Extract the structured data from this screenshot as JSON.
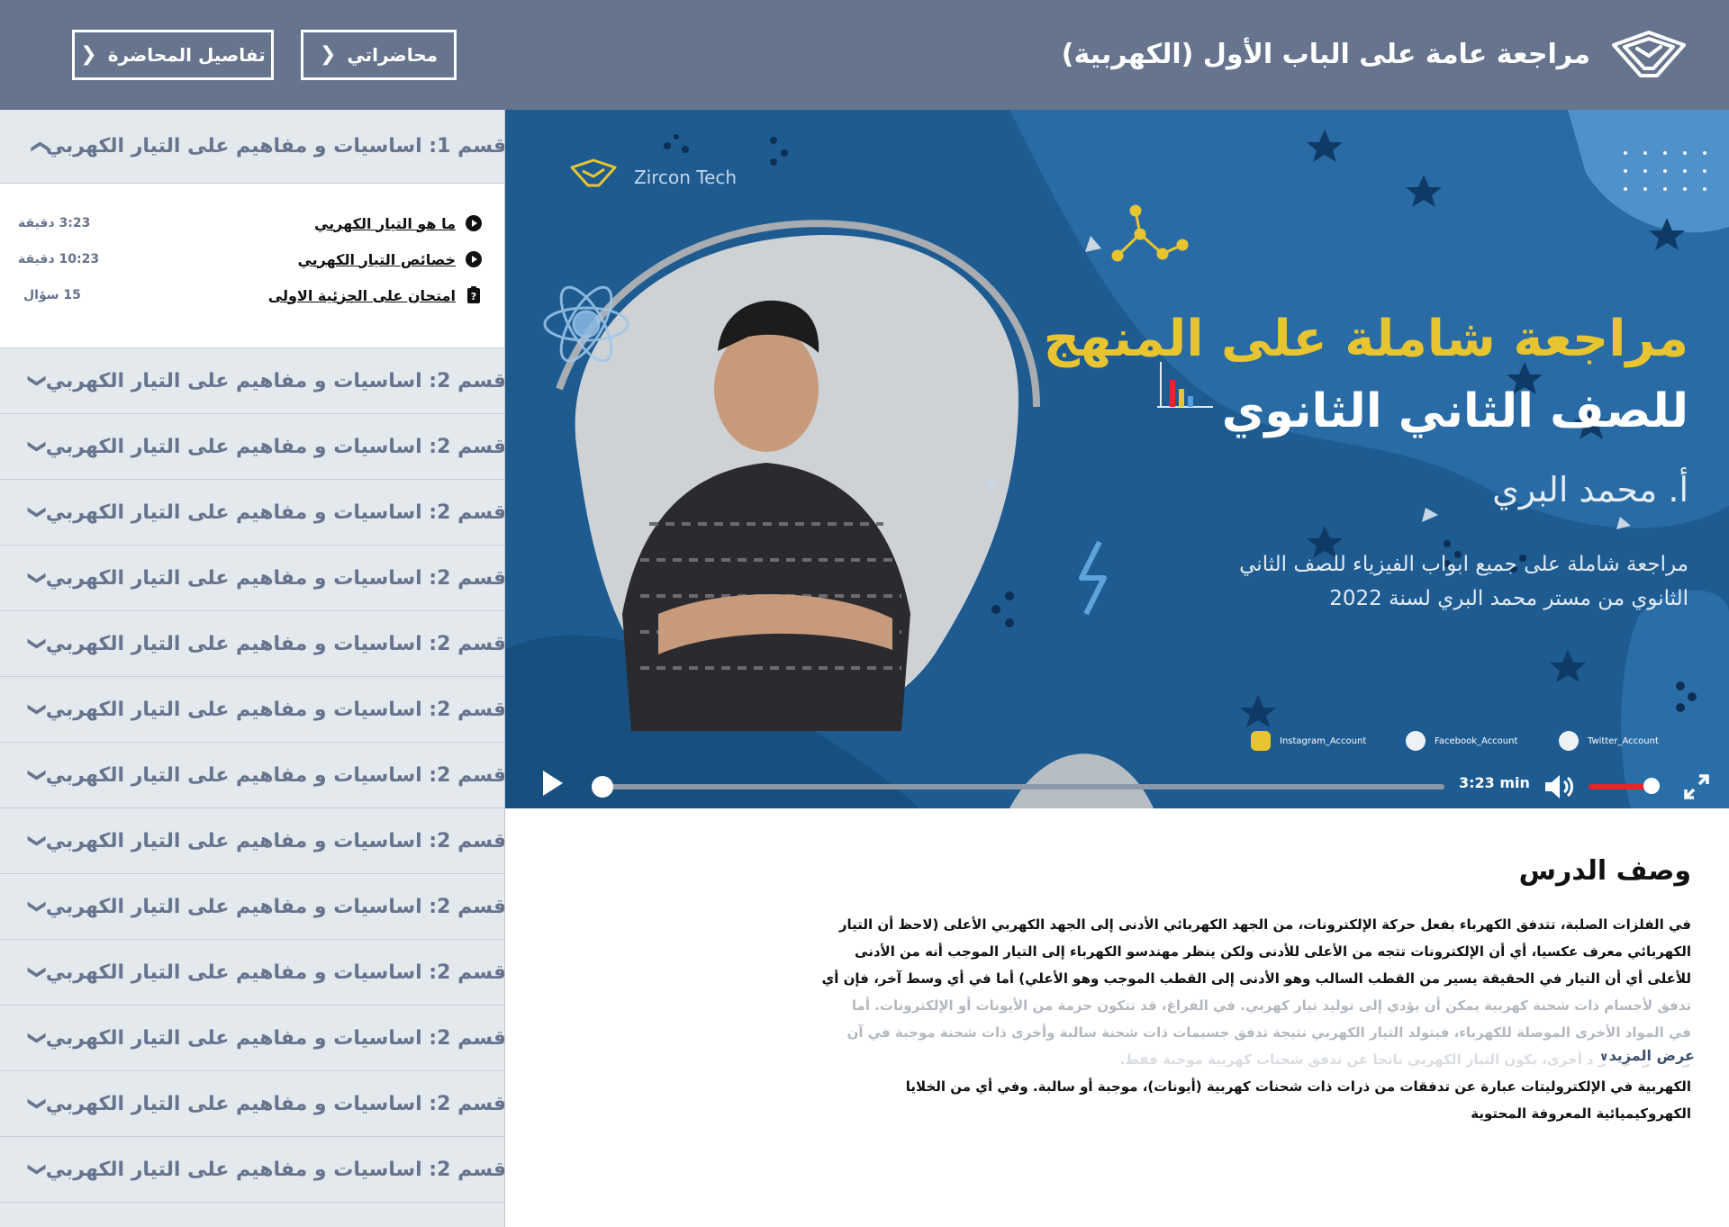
{
  "header": {
    "title": "مراجعة عامة على الباب الأول (الكهربية)",
    "my_lectures": "محاضراتي",
    "lecture_details": "تفاصيل المحاضرة"
  },
  "sidebar": {
    "open_section": {
      "title": "قسم 1: اساسيات و مفاهيم على التيار الكهربي",
      "lessons": [
        {
          "title": "ما هو التيار الكهربي",
          "meta": "3:23 دقيقة",
          "icon": "play-circle-icon"
        },
        {
          "title": "خصائص التيار الكهربي",
          "meta": "10:23 دقيقة",
          "icon": "play-circle-icon"
        },
        {
          "title": "امتحان على الجزئية الاولى",
          "meta": "15 سؤال",
          "icon": "quiz-icon"
        }
      ]
    },
    "sections": [
      "قسم 2: اساسيات و مفاهيم على التيار الكهربي",
      "قسم 2: اساسيات و مفاهيم على التيار الكهربي",
      "قسم 2: اساسيات و مفاهيم على التيار الكهربي",
      "قسم 2: اساسيات و مفاهيم على التيار الكهربي",
      "قسم 2: اساسيات و مفاهيم على التيار الكهربي",
      "قسم 2: اساسيات و مفاهيم على التيار الكهربي",
      "قسم 2: اساسيات و مفاهيم على التيار الكهربي",
      "قسم 2: اساسيات و مفاهيم على التيار الكهربي",
      "قسم 2: اساسيات و مفاهيم على التيار الكهربي",
      "قسم 2: اساسيات و مفاهيم على التيار الكهربي",
      "قسم 2: اساسيات و مفاهيم على التيار الكهربي",
      "قسم 2: اساسيات و مفاهيم على التيار الكهربي",
      "قسم 2: اساسيات و مفاهيم على التيار الكهربي"
    ]
  },
  "video": {
    "brand": "Zircon Tech",
    "headline1": "مراجعة شاملة على المنهج",
    "headline2": "للصف الثاني الثانوي",
    "teacher": "أ. محمد البري",
    "desc1": "مراجعة شاملة على جميع ابواب الفيزياء للصف الثاني",
    "desc2": "الثانوي من مستر محمد البري لسنة 2022",
    "socials": [
      {
        "label": "Instagram_Account",
        "icon": "instagram-icon"
      },
      {
        "label": "Facebook_Account",
        "icon": "facebook-icon"
      },
      {
        "label": "Twitter_Account",
        "icon": "twitter-icon"
      }
    ],
    "time": "3:23 min",
    "progress": 0,
    "volume": 0.85,
    "colors": {
      "accent": "#e8c530",
      "bg": "#1d5b91",
      "volume": "#e8232a"
    }
  },
  "description": {
    "title": "وصف الدرس",
    "lines": [
      "في الفلزات الصلبة، تتدفق الكهرباء بفعل حركة الإلكترونات، من الجهد الكهربائي الأدنى إلى الجهد الكهربي الأعلى (لاحظ أن التيار",
      "الكهربائي معرف عكسيا، أي أن الإلكترونات تتجه من الأعلى للأدنى ولكن ينظر مهندسو الكهرباء إلى التيار الموجب أنه من الأدنى",
      "للأعلى أي أن التيار في الحقيقة يسير من القطب السالب وهو الأدنى إلى القطب الموجب وهو الأعلي) أما في أي وسط آخر، فإن أي",
      "تدفق لأجسام ذات شحنة كهربية يمكن أن يؤدي إلى توليد تيار كهربي. في الفراغ، قد تتكون حزمة من الأيونات أو الإلكترونات. أما",
      "في المواد الأخرى الموصلة للكهرباء، فيتولد التيار الكهربي نتيجة تدفق جسيمات ذات شحنة سالبة وأخرى ذات شحنة موجبة في آن",
      "واحد. وفي مواد أخرى، يكون التيار الكهربي ناتجا عن تدفق شحنات كهربية موجبة فقط."
    ],
    "more": "عرض المزيد",
    "tail": [
      "الكهربية في الإلكتروليتات عبارة عن تدفقات من ذرات ذات شحنات كهربية (أيونات)، موجبة أو سالبة. وفي أي من الخلايا",
      "الكهروكيميائية المعروفة المحتوية"
    ]
  }
}
